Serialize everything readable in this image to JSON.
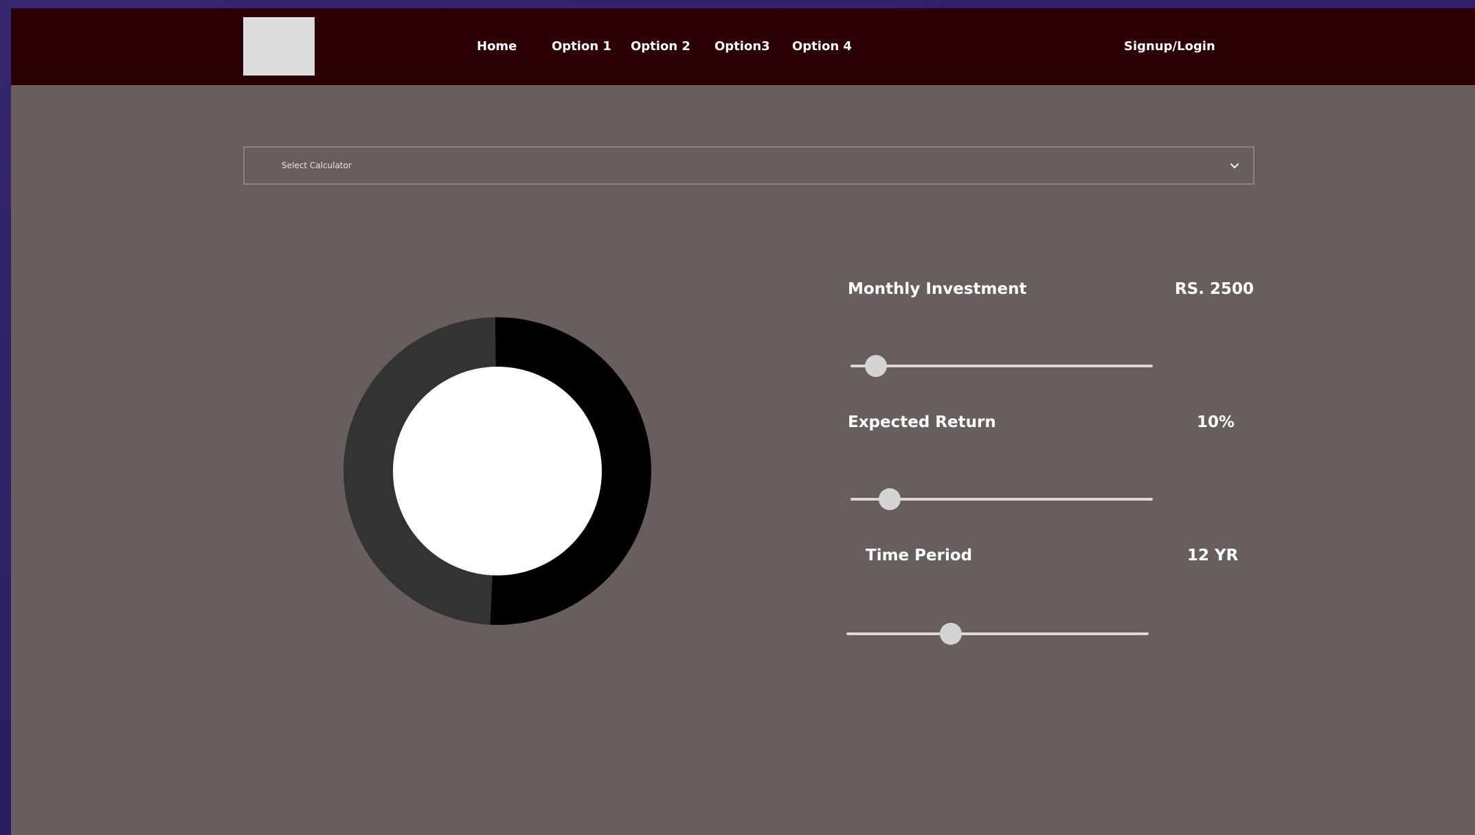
{
  "nav": {
    "logo": "logo-placeholder",
    "links": [
      "Home",
      "Option 1",
      "Option 2",
      "Option3",
      "Option 4"
    ],
    "signup_login": "Signup/Login"
  },
  "calculator_select": {
    "selected_value": "Select Calculator",
    "icon": "chevron-down-icon"
  },
  "chart_data": {
    "type": "pie",
    "style": "donut",
    "series": [
      {
        "value": 51,
        "color": "#000000"
      },
      {
        "value": 49,
        "color": "#333333"
      }
    ],
    "center_color": "#ffffff"
  },
  "fields": {
    "monthly_investment": {
      "label": "Monthly Investment",
      "value": "RS. 2500",
      "slider_fraction": 0.085
    },
    "expected_return": {
      "label": "Expected Return",
      "value": "10%",
      "slider_fraction": 0.13
    },
    "time_period": {
      "label": "Time Period",
      "value": "12 YR",
      "slider_fraction": 0.345
    }
  },
  "colors": {
    "navbar": "#2d0006",
    "content_bg": "#675e5d",
    "outer_bg": "#2c1f63",
    "text": "#ffffff",
    "slider": "#d9d9d9"
  }
}
